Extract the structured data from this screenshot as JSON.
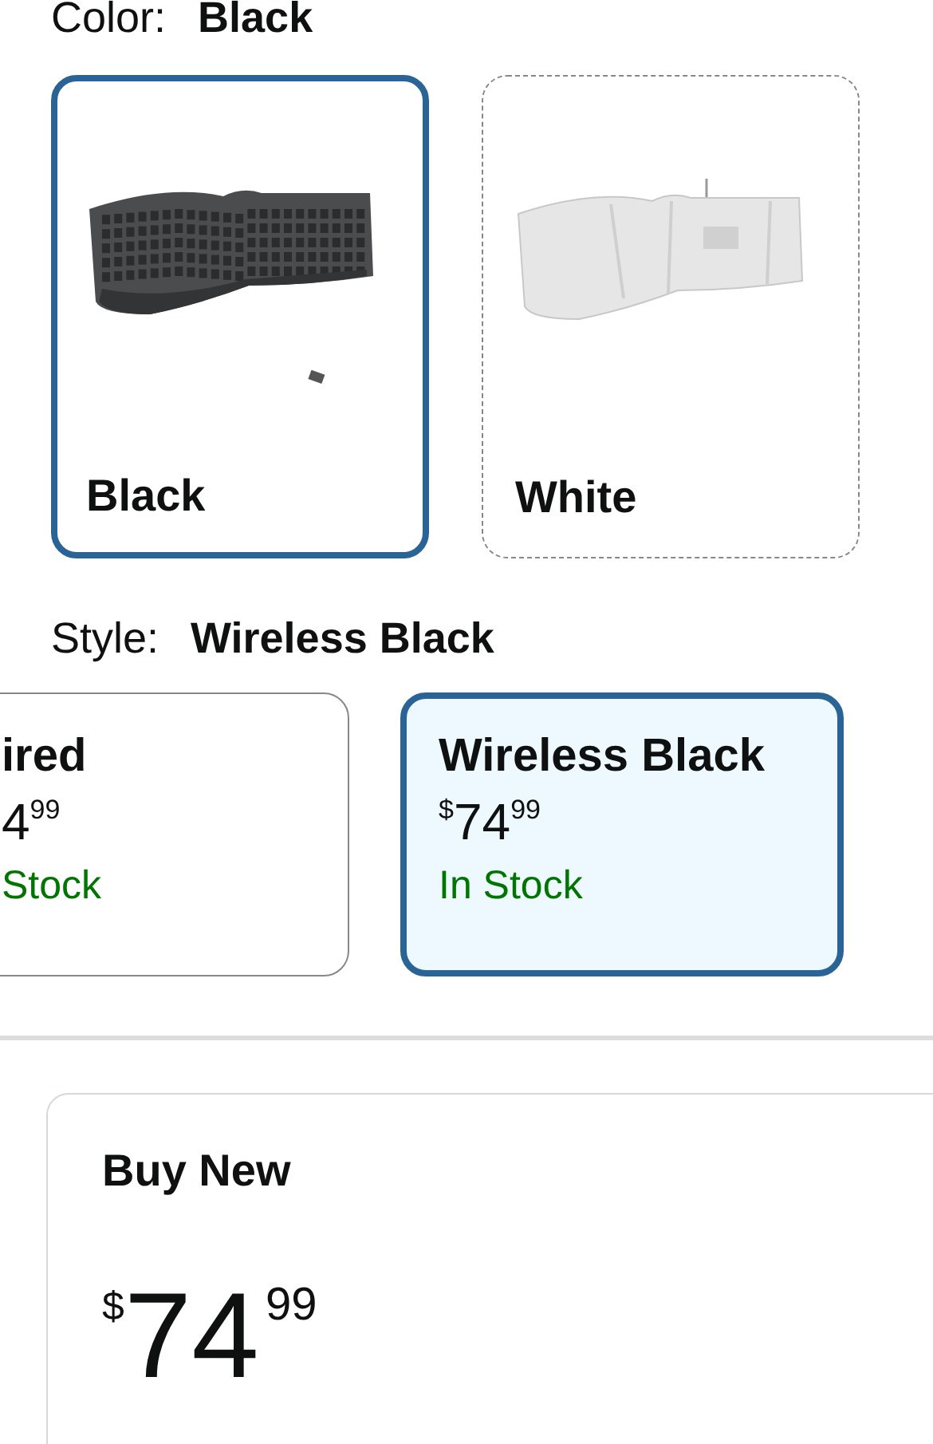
{
  "color_selector": {
    "label": "Color:",
    "value": "Black",
    "options": [
      {
        "name": "Black",
        "kind": "keyboard-top",
        "selected": true,
        "available": true
      },
      {
        "name": "White",
        "kind": "keyboard-underside",
        "selected": false,
        "available": false
      }
    ]
  },
  "style_selector": {
    "label": "Style:",
    "value": "Wireless Black",
    "options": [
      {
        "name": "ired",
        "price_whole": "4",
        "price_fraction": "99",
        "stock": "Stock",
        "selected": false
      },
      {
        "name": "Wireless Black",
        "currency": "$",
        "price_whole": "74",
        "price_fraction": "99",
        "stock": "In Stock",
        "selected": true
      }
    ]
  },
  "buy_box": {
    "title": "Buy New",
    "currency": "$",
    "price_whole": "74",
    "price_fraction": "99"
  }
}
